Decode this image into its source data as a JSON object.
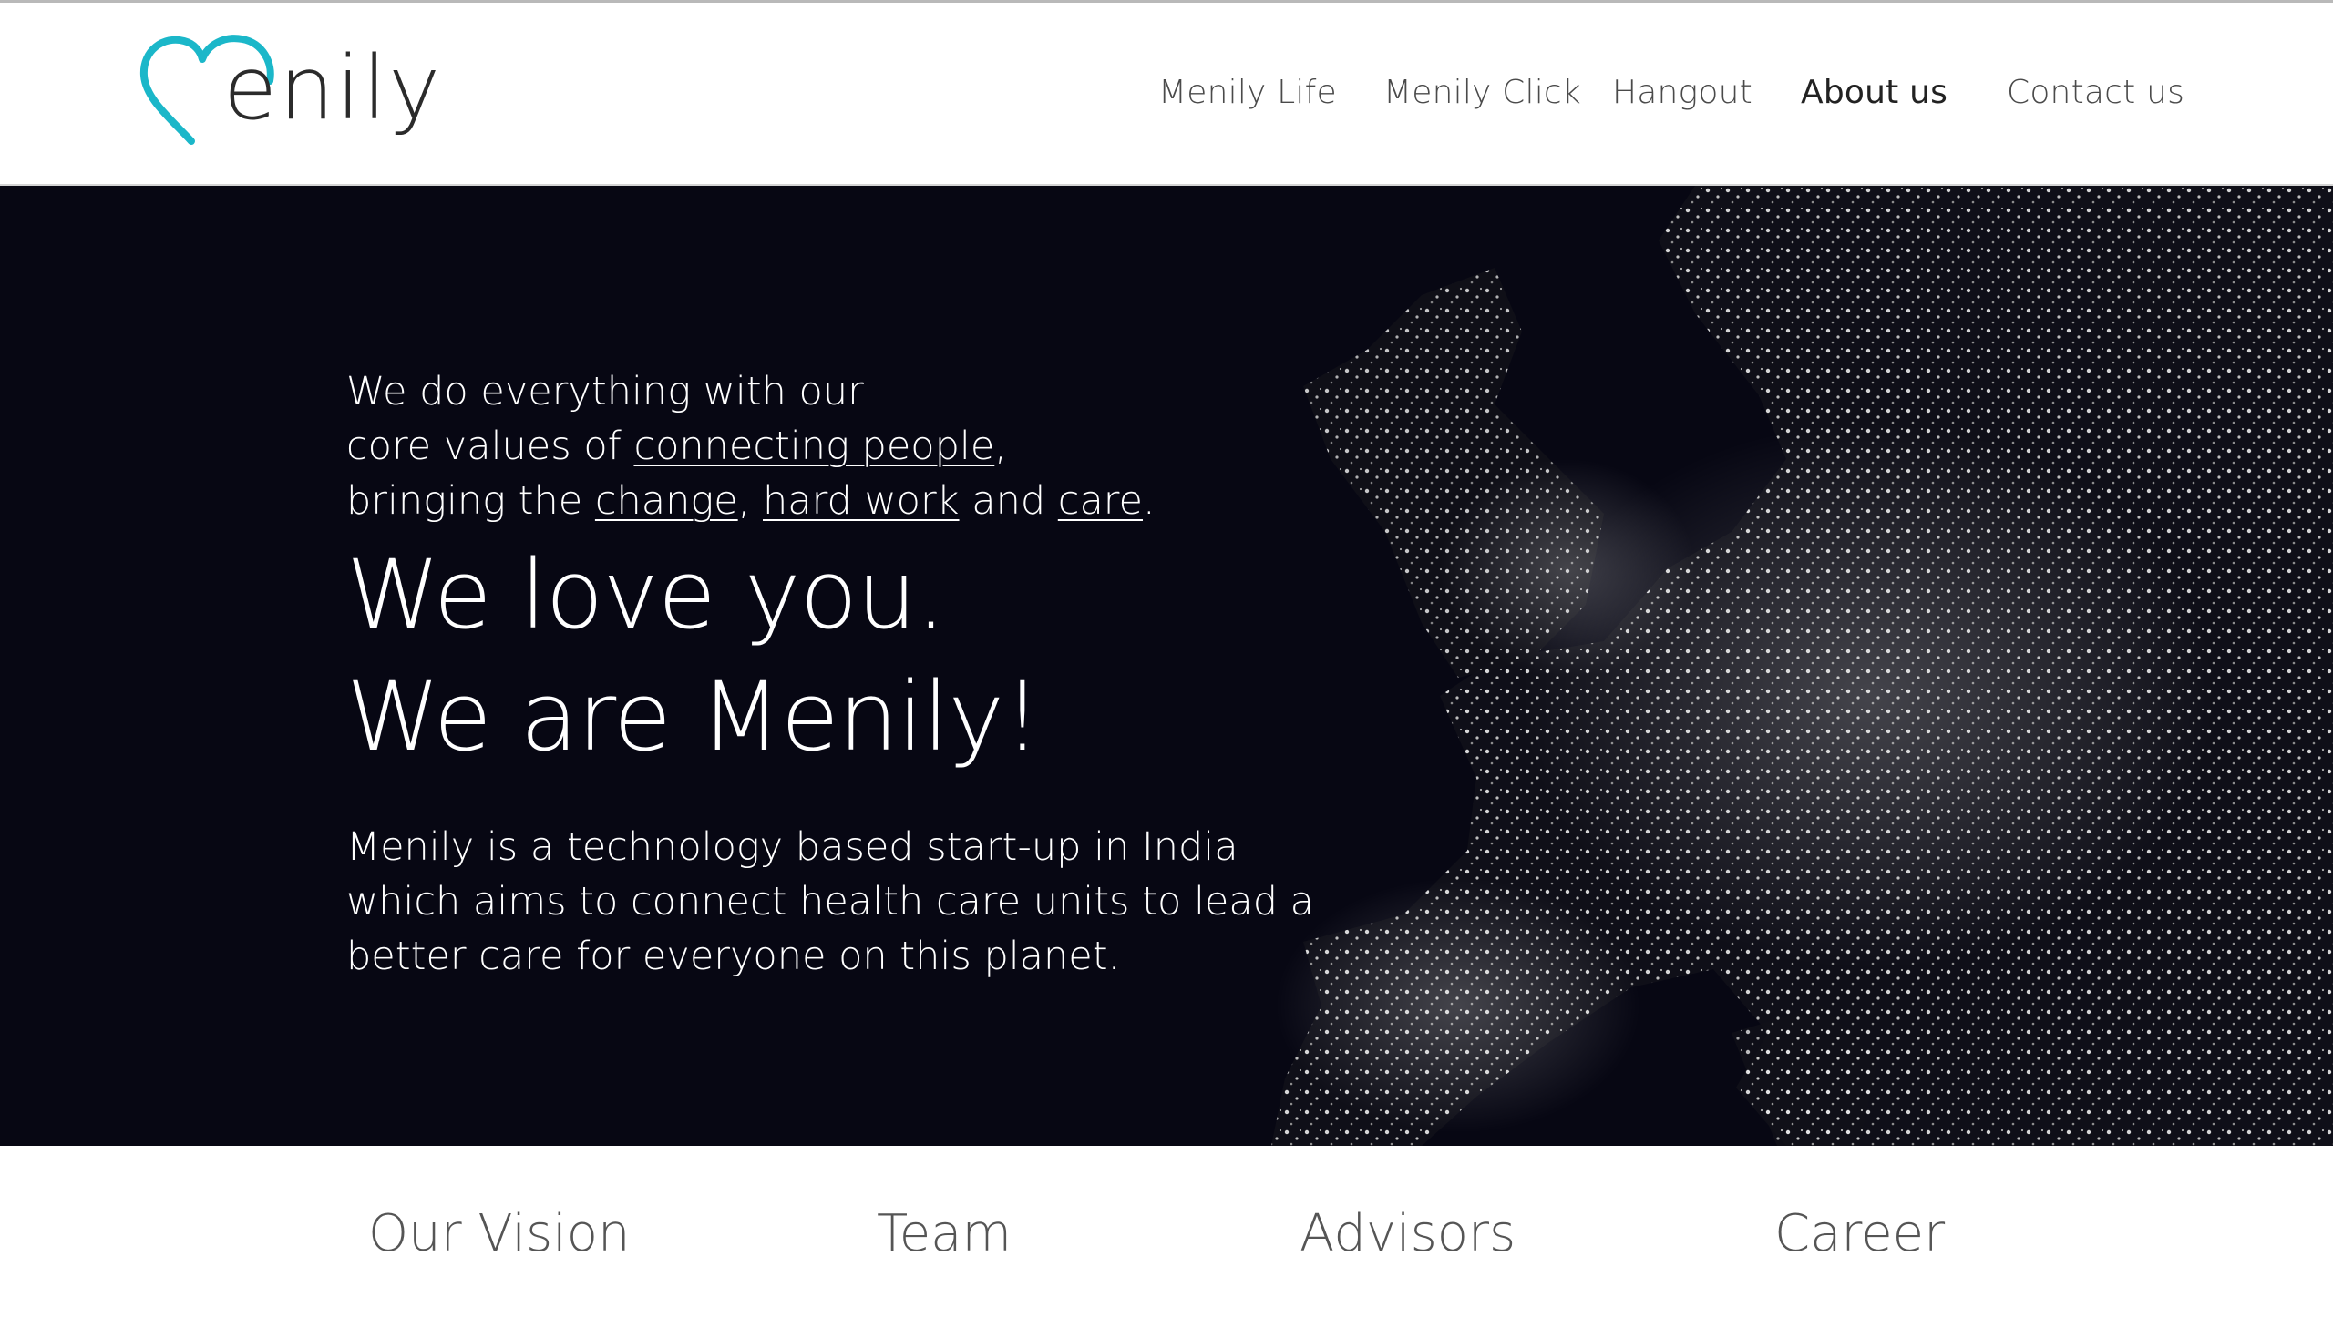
{
  "brand": {
    "logo_text": "enily",
    "colors": {
      "heart": "#1bb7c9",
      "text": "#2b2b2b"
    }
  },
  "nav": {
    "items": [
      {
        "label": "Menily Life",
        "active": false
      },
      {
        "label": "Menily Click",
        "active": false
      },
      {
        "label": "Hangout",
        "active": false
      },
      {
        "label": "About us",
        "active": true
      },
      {
        "label": "Contact us",
        "active": false
      }
    ]
  },
  "hero": {
    "intro": {
      "line1": "We do everything with our",
      "line2_prefix": "core values of ",
      "link_connecting": "connecting people",
      "line2_suffix": ",",
      "line3_prefix": "bringing the ",
      "link_change": "change",
      "sep1": ", ",
      "link_hard_work": "hard work",
      "sep2": " and ",
      "link_care": "care",
      "line3_suffix": "."
    },
    "headline1": "We love you.",
    "headline2": "We are Menily!",
    "description": "Menily is a technology based start-up in India which aims to connect health care units to lead a better care for everyone on this planet.",
    "background_color": "#070713"
  },
  "tabs": [
    {
      "label": "Our Vision"
    },
    {
      "label": "Team"
    },
    {
      "label": "Advisors"
    },
    {
      "label": "Career"
    }
  ]
}
